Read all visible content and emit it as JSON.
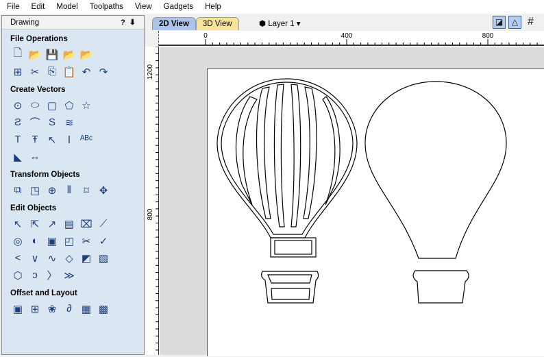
{
  "menu": [
    "File",
    "Edit",
    "Model",
    "Toolpaths",
    "View",
    "Gadgets",
    "Help"
  ],
  "panel": {
    "title": "Drawing",
    "help": "?",
    "pin": "⬇",
    "sections": [
      {
        "title": "File Operations",
        "rows": [
          [
            "new-file",
            "open-folder",
            "save",
            "open-folder-2",
            "import"
          ],
          [
            "select-all",
            "cut",
            "copy",
            "paste",
            "undo",
            "redo"
          ]
        ]
      },
      {
        "title": "Create Vectors",
        "rows": [
          [
            "circle",
            "ellipse",
            "rectangle",
            "polygon",
            "star"
          ],
          [
            "polyline",
            "arc",
            "curve",
            "wave"
          ],
          [
            "text",
            "text-box",
            "text-on-curve",
            "auto-text",
            "text-arc"
          ],
          [
            "bitmap-trace",
            "dimension"
          ]
        ]
      },
      {
        "title": "Transform Objects",
        "rows": [
          [
            "move",
            "scale",
            "rotate",
            "mirror",
            "distort",
            "align"
          ]
        ]
      },
      {
        "title": "Edit Objects",
        "rows": [
          [
            "node-edit",
            "select-node",
            "interactive-select",
            "group",
            "ungroup",
            "measure"
          ],
          [
            "weld",
            "trim",
            "offset",
            "fillet",
            "scissors",
            "smooth"
          ],
          [
            "join",
            "node-join",
            "curve-fit",
            "close",
            "extend",
            "bitmap"
          ],
          [
            "vector-select",
            "close-open",
            "smooth-node",
            "chamfer"
          ]
        ]
      },
      {
        "title": "Offset and Layout",
        "rows": [
          [
            "offset",
            "array",
            "nest",
            "path",
            "qr-code",
            "tile"
          ]
        ]
      }
    ]
  },
  "tabs": [
    {
      "label": "2D View",
      "active": true
    },
    {
      "label": "3D View",
      "active": false
    }
  ],
  "layer": "Layer 1",
  "hruler": [
    "0",
    "400",
    "800"
  ],
  "vruler": [
    "1200",
    "800"
  ]
}
